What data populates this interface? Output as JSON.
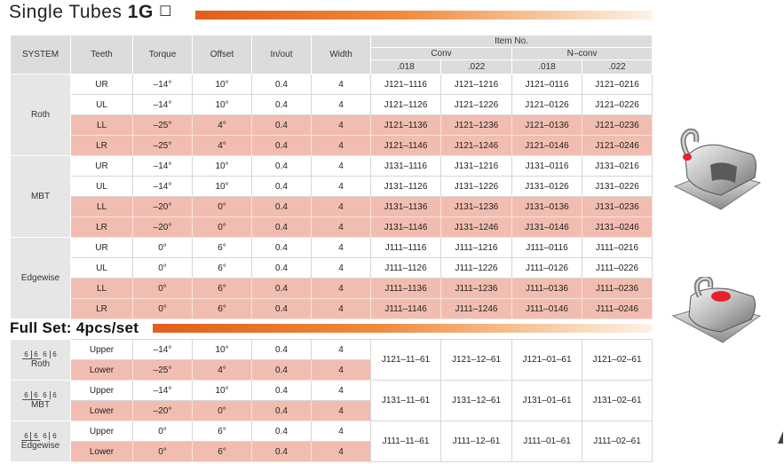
{
  "title": {
    "prefix": "Single Tubes ",
    "bold": "1G",
    "box": "☐"
  },
  "table1": {
    "headers": {
      "system": "SYSTEM",
      "teeth": "Teeth",
      "torque": "Torque",
      "offset": "Offset",
      "inout": "In/out",
      "width": "Width",
      "item_no": "Item No.",
      "conv": "Conv",
      "nconv": "N–conv",
      "c1": ".018",
      "c2": ".022",
      "c3": ".018",
      "c4": ".022"
    },
    "groups": [
      {
        "system": "Roth",
        "rows": [
          {
            "teeth": "UR",
            "torque": "–14°",
            "offset": "10°",
            "inout": "0.4",
            "width": "4",
            "c1": "J121–1116",
            "c2": "J121–1216",
            "c3": "J121–0116",
            "c4": "J121–0216"
          },
          {
            "teeth": "UL",
            "torque": "–14°",
            "offset": "10°",
            "inout": "0.4",
            "width": "4",
            "c1": "J121–1126",
            "c2": "J121–1226",
            "c3": "J121–0126",
            "c4": "J121–0226"
          },
          {
            "teeth": "LL",
            "torque": "–25°",
            "offset": "4°",
            "inout": "0.4",
            "width": "4",
            "c1": "J121–1136",
            "c2": "J121–1236",
            "c3": "J121–0136",
            "c4": "J121–0236"
          },
          {
            "teeth": "LR",
            "torque": "–25°",
            "offset": "4°",
            "inout": "0.4",
            "width": "4",
            "c1": "J121–1146",
            "c2": "J121–1246",
            "c3": "J121–0146",
            "c4": "J121–0246"
          }
        ]
      },
      {
        "system": "MBT",
        "rows": [
          {
            "teeth": "UR",
            "torque": "–14°",
            "offset": "10°",
            "inout": "0.4",
            "width": "4",
            "c1": "J131–1116",
            "c2": "J131–1216",
            "c3": "J131–0116",
            "c4": "J131–0216"
          },
          {
            "teeth": "UL",
            "torque": "–14°",
            "offset": "10°",
            "inout": "0.4",
            "width": "4",
            "c1": "J131–1126",
            "c2": "J131–1226",
            "c3": "J131–0126",
            "c4": "J131–0226"
          },
          {
            "teeth": "LL",
            "torque": "–20°",
            "offset": "0°",
            "inout": "0.4",
            "width": "4",
            "c1": "J131–1136",
            "c2": "J131–1236",
            "c3": "J131–0136",
            "c4": "J131–0236"
          },
          {
            "teeth": "LR",
            "torque": "–20°",
            "offset": "0°",
            "inout": "0.4",
            "width": "4",
            "c1": "J131–1146",
            "c2": "J131–1246",
            "c3": "J131–0146",
            "c4": "J131–0246"
          }
        ]
      },
      {
        "system": "Edgewise",
        "rows": [
          {
            "teeth": "UR",
            "torque": "0°",
            "offset": "6°",
            "inout": "0.4",
            "width": "4",
            "c1": "J111–1116",
            "c2": "J111–1216",
            "c3": "J111–0116",
            "c4": "J111–0216"
          },
          {
            "teeth": "UL",
            "torque": "0°",
            "offset": "6°",
            "inout": "0.4",
            "width": "4",
            "c1": "J111–1126",
            "c2": "J111–1226",
            "c3": "J111–0126",
            "c4": "J111–0226"
          },
          {
            "teeth": "LL",
            "torque": "0°",
            "offset": "6°",
            "inout": "0.4",
            "width": "4",
            "c1": "J111–1136",
            "c2": "J111–1236",
            "c3": "J111–0136",
            "c4": "J111–0236"
          },
          {
            "teeth": "LR",
            "torque": "0°",
            "offset": "6°",
            "inout": "0.4",
            "width": "4",
            "c1": "J111–1146",
            "c2": "J111–1246",
            "c3": "J111–0146",
            "c4": "J111–0246"
          }
        ]
      }
    ]
  },
  "fullset": {
    "heading": "Full Set: 4pcs/set",
    "quad": {
      "ul": "6",
      "ur": "6",
      "ll": "6",
      "lr": "6"
    },
    "groups": [
      {
        "system": "Roth",
        "rows": [
          {
            "arch": "Upper",
            "torque": "–14°",
            "offset": "10°",
            "inout": "0.4",
            "width": "4"
          },
          {
            "arch": "Lower",
            "torque": "–25°",
            "offset": "4°",
            "inout": "0.4",
            "width": "4"
          }
        ],
        "c1": "J121–11–61",
        "c2": "J121–12–61",
        "c3": "J121–01–61",
        "c4": "J121–02–61"
      },
      {
        "system": "MBT",
        "rows": [
          {
            "arch": "Upper",
            "torque": "–14°",
            "offset": "10°",
            "inout": "0.4",
            "width": "4"
          },
          {
            "arch": "Lower",
            "torque": "–20°",
            "offset": "0°",
            "inout": "0.4",
            "width": "4"
          }
        ],
        "c1": "J131–11–61",
        "c2": "J131–12–61",
        "c3": "J131–01–61",
        "c4": "J131–02–61"
      },
      {
        "system": "Edgewise",
        "rows": [
          {
            "arch": "Upper",
            "torque": "0°",
            "offset": "6°",
            "inout": "0.4",
            "width": "4"
          },
          {
            "arch": "Lower",
            "torque": "0°",
            "offset": "6°",
            "inout": "0.4",
            "width": "4"
          }
        ],
        "c1": "J111–11–61",
        "c2": "J111–12–61",
        "c3": "J111–01–61",
        "c4": "J111–02–61"
      }
    ]
  },
  "images": {
    "tube_top": "buccal-tube-bracket-image",
    "tube_bottom": "buccal-tube-bracket-image",
    "accent": "#e25e1c",
    "highlight": "#f1bdb1",
    "marker": "#e8202a"
  }
}
